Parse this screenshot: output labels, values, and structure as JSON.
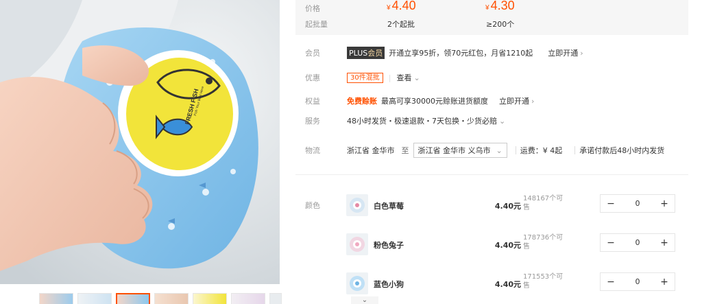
{
  "price_block": {
    "price_label": "价格",
    "min_label": "起批量",
    "tiers": [
      {
        "yen": "¥",
        "price": "4.40",
        "min": "2个起批"
      },
      {
        "yen": "¥",
        "price": "4.30",
        "min": "≥200个"
      }
    ]
  },
  "member": {
    "label": "会员",
    "badge_plain": "PLUS",
    "badge_gold": "会员",
    "text": "开通立享95折，领70元红包，月省1210起",
    "link": "立即开通",
    "chevron": "›"
  },
  "discount": {
    "label": "优惠",
    "tag": "30件混批",
    "view": "查看",
    "chevron": "⌄"
  },
  "rights": {
    "label": "权益",
    "tag": "免费赊账",
    "text": "最高可享30000元赊账进货额度",
    "link": "立即开通",
    "chevron": "›"
  },
  "service": {
    "label": "服务",
    "text": "48小时发货・极速退款・7天包换・少货必赔",
    "chevron": "⌄"
  },
  "logistics": {
    "label": "物流",
    "from": "浙江省 金华市",
    "to_word": "至",
    "destination": "浙江省 金华市 义乌市",
    "destination_chevron": "⌄",
    "freight": "运费：¥ 4起",
    "promise": "承诺付款后48小时内发货"
  },
  "sku": {
    "label": "颜色",
    "items": [
      {
        "name": "白色草莓",
        "price": "4.40元",
        "stock_line1": "148167个可",
        "stock_line2": "售",
        "qty": "0",
        "minus": "−",
        "plus": "+"
      },
      {
        "name": "粉色兔子",
        "price": "4.40元",
        "stock_line1": "178736个可",
        "stock_line2": "售",
        "qty": "0",
        "minus": "−",
        "plus": "+"
      },
      {
        "name": "蓝色小狗",
        "price": "4.40元",
        "stock_line1": "171553个可",
        "stock_line2": "售",
        "qty": "0",
        "minus": "−",
        "plus": "+"
      }
    ],
    "more_chevron": "⌄"
  },
  "image": {
    "lid_text": "FRESH FISH",
    "lid_subtext": "Fish Your Best Here",
    "thumbnails": [
      "thumb-1",
      "thumb-2",
      "thumb-3",
      "thumb-4",
      "thumb-5",
      "thumb-6",
      "thumb-7"
    ],
    "active_thumbnail": 3
  },
  "colors": {
    "accent": "#ff5000",
    "price_bg": "#f6f6f6",
    "lid_yellow": "#f2e43a",
    "bag_blue": "#8cc8ef"
  }
}
